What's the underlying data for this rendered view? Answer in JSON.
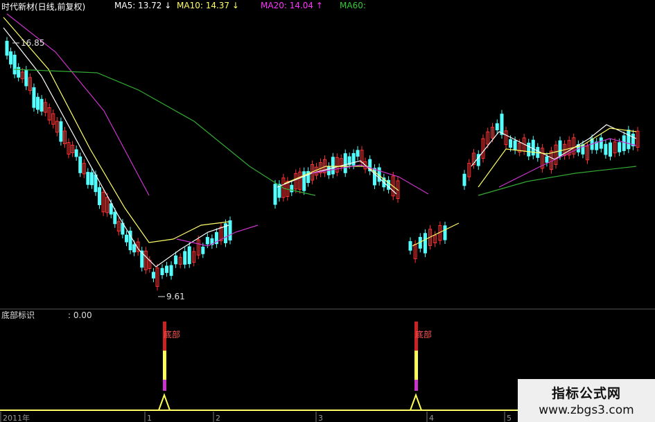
{
  "title": "时代新材(日线,前复权)",
  "ma_header": [
    {
      "label": "MA5: 13.72",
      "arrow": "↓",
      "color": "#ffffff"
    },
    {
      "label": "MA10: 14.37",
      "arrow": "↓",
      "color": "#ffff66"
    },
    {
      "label": "MA20: 14.04",
      "arrow": "↑",
      "color": "#ff33ff"
    },
    {
      "label": "MA60:",
      "arrow": "",
      "color": "#33cc33"
    }
  ],
  "price_high_label": "16.85",
  "price_low_label": "9.61",
  "indicator_title": "底部标识",
  "indicator_value": ": 0.00",
  "signal_label": "底部",
  "x_axis_labels": [
    "2011年",
    "1",
    "2",
    "3",
    "4",
    "5"
  ],
  "watermark": {
    "name": "指标公式网",
    "url": "www.zbgs3.com"
  },
  "colors": {
    "up": "#ff3333",
    "down": "#54ffff",
    "ma5": "#ffffff",
    "ma10": "#ffff66",
    "ma20": "#cc33cc",
    "ma60": "#33aa33"
  },
  "chart_data": {
    "type": "candlestick",
    "title": "时代新材(日线,前复权)",
    "series": [
      {
        "name": "MA5",
        "current": 13.72
      },
      {
        "name": "MA10",
        "current": 14.37
      },
      {
        "name": "MA20",
        "current": 14.04
      }
    ],
    "annotations": {
      "high": 16.85,
      "low": 9.61
    },
    "sub_indicator": {
      "name": "底部标识",
      "value": 0.0,
      "signals": [
        "底部",
        "底部"
      ]
    }
  }
}
